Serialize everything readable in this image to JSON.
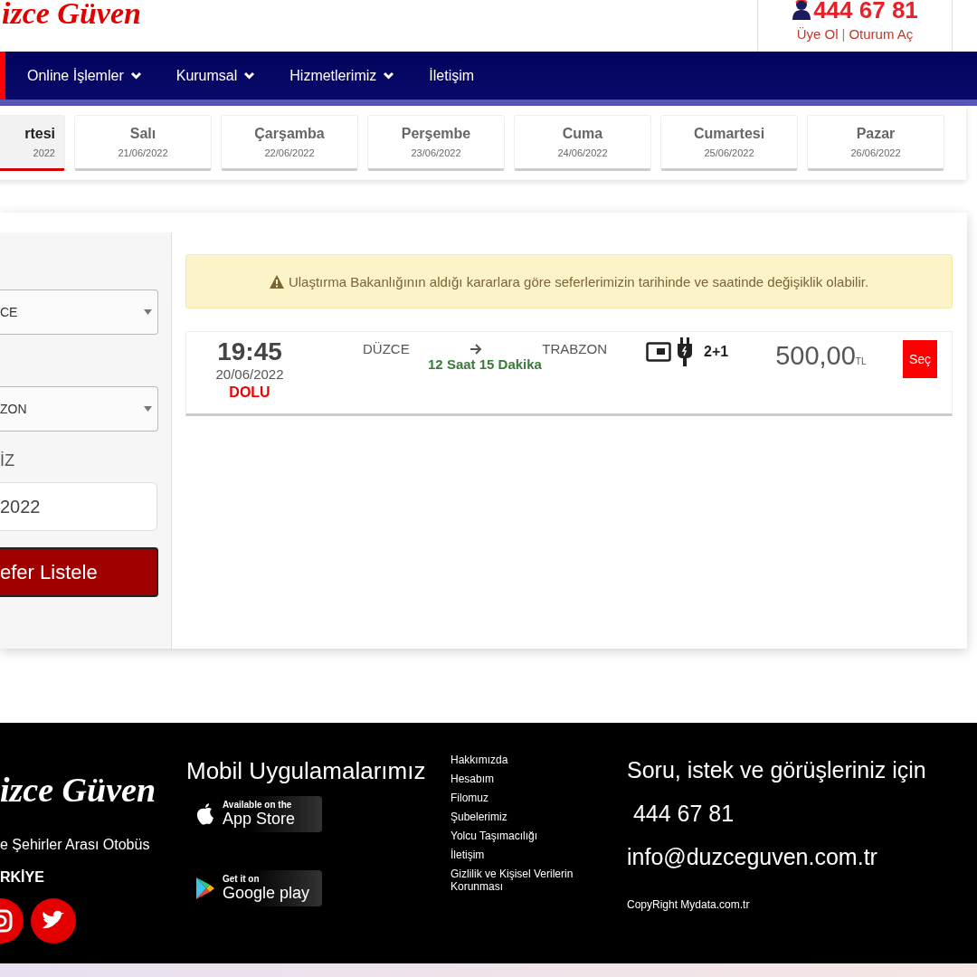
{
  "header": {
    "logo": "izce Güven",
    "phone": "444 67 81",
    "links": [
      {
        "label": "Üye Ol"
      },
      {
        "label": "Oturum Aç"
      }
    ],
    "separator": "|"
  },
  "nav": {
    "items": [
      {
        "label": "Online İşlemler",
        "dropdown": true
      },
      {
        "label": "Kurumsal",
        "dropdown": true
      },
      {
        "label": "Hizmetlerimiz",
        "dropdown": true
      },
      {
        "label": "İletişim",
        "dropdown": false
      }
    ]
  },
  "day_tabs": [
    {
      "day": "rtesi",
      "date": "2022",
      "selected": true
    },
    {
      "day": "Salı",
      "date": "21/06/2022",
      "selected": false
    },
    {
      "day": "Çarşamba",
      "date": "22/06/2022",
      "selected": false
    },
    {
      "day": "Perşembe",
      "date": "23/06/2022",
      "selected": false
    },
    {
      "day": "Cuma",
      "date": "24/06/2022",
      "selected": false
    },
    {
      "day": "Cumartesi",
      "date": "25/06/2022",
      "selected": false
    },
    {
      "day": "Pazar",
      "date": "26/06/2022",
      "selected": false
    }
  ],
  "search_form": {
    "from_value": "CE",
    "to_value": "ZON",
    "date_label": "İZ",
    "date_value": "2022",
    "submit": "efer Listele"
  },
  "notice": {
    "text": "Ulaştırma Bakanlığının aldığı kararlara göre seferlerimizin tarihinde ve saatinde değişiklik olabilir."
  },
  "trips": [
    {
      "time": "19:45",
      "date": "20/06/2022",
      "status": "DOLU",
      "from": "DÜZCE",
      "to": "TRABZON",
      "duration": "12 Saat 15 Dakika",
      "seating": "2+1",
      "price": "500,00",
      "currency": "TL",
      "button": "Seç"
    }
  ],
  "footer": {
    "logo": "izce Güven",
    "tagline": "e Şehirler Arası Otobüs",
    "country": "RKİYE",
    "apps_title": "Mobil Uygulamalarımız",
    "app_store": {
      "small": "Available on the",
      "big": "App Store"
    },
    "google_play": {
      "small": "Get it on",
      "big": "Google play"
    },
    "links": [
      "Hakkımızda",
      "Hesabım",
      "Filomuz",
      "Şubelerimiz",
      "Yolcu Taşımacılığı",
      "İletişim",
      "Gizlilik ve Kişisel Verilerin Korunması"
    ],
    "contact_title": "Soru, istek ve görüşleriniz için",
    "phone": " 444 67 81",
    "email": "info@duzceguven.com.tr",
    "copyright": "CopyRight Mydata.com.tr"
  }
}
